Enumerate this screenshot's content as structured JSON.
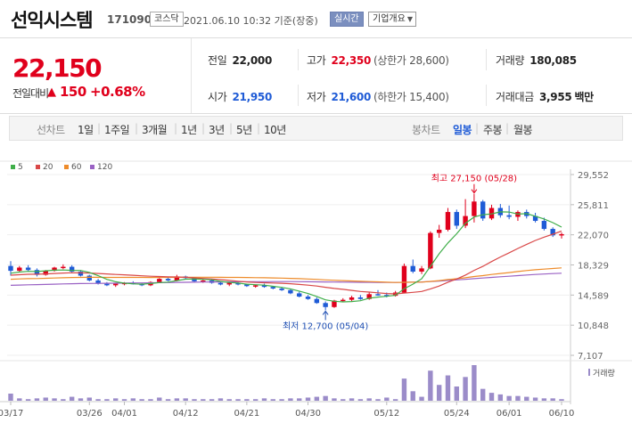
{
  "header": {
    "title": "선익시스템",
    "code": "171090",
    "market": "코스닥",
    "datetime": "2021.06.10 10:32 기준(장중)",
    "live_label": "실시간",
    "info_label": "기업개요"
  },
  "quote": {
    "price": "22,150",
    "change_label": "전일대비",
    "change_arrow": "▲",
    "change_value": "150",
    "change_pct": "+0.68%",
    "stats": {
      "prev_close": {
        "label": "전일",
        "value": "22,000"
      },
      "open": {
        "label": "시가",
        "value": "21,950"
      },
      "high": {
        "label": "고가",
        "value": "22,350",
        "sub": "(상한가 28,600)"
      },
      "low": {
        "label": "저가",
        "value": "21,600",
        "sub": "(하한가 15,400)"
      },
      "volume": {
        "label": "거래량",
        "value": "180,085"
      },
      "amount": {
        "label": "거래대금",
        "value": "3,955",
        "unit": "백만"
      }
    }
  },
  "toolbar": {
    "line_label": "선차트",
    "periods": [
      "1일",
      "1주일",
      "3개월",
      "1년",
      "3년",
      "5년",
      "10년"
    ],
    "candle_label": "봉차트",
    "candles": [
      "일봉",
      "주봉",
      "월봉"
    ],
    "active_candle": "일봉"
  },
  "colors": {
    "up": "#e0001c",
    "down": "#1f5bd6",
    "ma5": "#3fae49",
    "ma20": "#d94848",
    "ma60": "#ee8c2b",
    "ma120": "#9a62c4",
    "volume": "#9b8cc9"
  },
  "chart_data": {
    "type": "candlestick",
    "legend": [
      "5",
      "20",
      "60",
      "120"
    ],
    "y_ticks": [
      "29,552",
      "25,811",
      "22,070",
      "18,329",
      "14,589",
      "10,848",
      "7,107"
    ],
    "ylim": [
      7107,
      29552
    ],
    "x_labels": [
      "03/17",
      "03/26",
      "04/01",
      "04/12",
      "04/21",
      "04/30",
      "05/12",
      "05/24",
      "06/01",
      "06/10"
    ],
    "max_annotation": "최고 27,150 (05/28)",
    "min_annotation": "최저 12,700 (05/04)",
    "volume_label": "거래량",
    "candles": [
      [
        18200,
        18800,
        17000,
        17600
      ],
      [
        17600,
        18200,
        17400,
        18000
      ],
      [
        18000,
        18300,
        17500,
        17700
      ],
      [
        17700,
        17900,
        16900,
        17100
      ],
      [
        17100,
        17700,
        17000,
        17600
      ],
      [
        17600,
        18100,
        17500,
        18000
      ],
      [
        18000,
        18400,
        17800,
        18100
      ],
      [
        18100,
        18300,
        17400,
        17500
      ],
      [
        17500,
        17600,
        16900,
        17000
      ],
      [
        17000,
        17100,
        16300,
        16400
      ],
      [
        16400,
        16600,
        15900,
        16000
      ],
      [
        16000,
        16200,
        15700,
        15800
      ],
      [
        15800,
        16100,
        15600,
        16000
      ],
      [
        16000,
        16200,
        15800,
        16100
      ],
      [
        16100,
        16300,
        15900,
        16000
      ],
      [
        16000,
        16100,
        15700,
        15800
      ],
      [
        15800,
        16300,
        15700,
        16200
      ],
      [
        16200,
        16700,
        16100,
        16600
      ],
      [
        16600,
        16800,
        16300,
        16400
      ],
      [
        16400,
        17100,
        16300,
        16900
      ],
      [
        16900,
        17000,
        16600,
        16700
      ],
      [
        16700,
        16800,
        16200,
        16300
      ],
      [
        16300,
        16500,
        16100,
        16400
      ],
      [
        16400,
        16600,
        16000,
        16100
      ],
      [
        16100,
        16300,
        15800,
        15900
      ],
      [
        15900,
        16200,
        15700,
        16100
      ],
      [
        16100,
        16300,
        15800,
        15900
      ],
      [
        15900,
        16000,
        15600,
        15700
      ],
      [
        15700,
        15900,
        15500,
        15800
      ],
      [
        15800,
        16000,
        15500,
        15600
      ],
      [
        15600,
        15700,
        15300,
        15400
      ],
      [
        15400,
        15600,
        15100,
        15200
      ],
      [
        15200,
        15300,
        14700,
        14800
      ],
      [
        14800,
        15000,
        14300,
        14400
      ],
      [
        14400,
        14600,
        14000,
        14100
      ],
      [
        14100,
        14300,
        13500,
        13600
      ],
      [
        13600,
        13800,
        12700,
        13100
      ],
      [
        13100,
        14000,
        13000,
        13900
      ],
      [
        13900,
        14200,
        13700,
        14000
      ],
      [
        14000,
        14500,
        13800,
        14300
      ],
      [
        14300,
        14600,
        14000,
        14100
      ],
      [
        14100,
        14900,
        14000,
        14700
      ],
      [
        14700,
        15200,
        14500,
        14600
      ],
      [
        14600,
        14900,
        14300,
        14500
      ],
      [
        14500,
        15100,
        14400,
        14900
      ],
      [
        14900,
        18500,
        14800,
        18200
      ],
      [
        18200,
        19000,
        17300,
        17500
      ],
      [
        17500,
        18200,
        17200,
        17900
      ],
      [
        17900,
        22500,
        17800,
        22300
      ],
      [
        22300,
        23300,
        21700,
        22700
      ],
      [
        22700,
        25400,
        22500,
        24900
      ],
      [
        24900,
        25200,
        22800,
        23200
      ],
      [
        23200,
        26500,
        22900,
        24400
      ],
      [
        24400,
        27150,
        23600,
        26200
      ],
      [
        26200,
        26400,
        23800,
        24100
      ],
      [
        24100,
        25800,
        23900,
        25400
      ],
      [
        25400,
        25900,
        24200,
        24500
      ],
      [
        24500,
        25700,
        24000,
        24300
      ],
      [
        24300,
        25100,
        23800,
        24900
      ],
      [
        24900,
        25200,
        24100,
        24400
      ],
      [
        24400,
        24800,
        23600,
        23800
      ],
      [
        23800,
        24200,
        22600,
        22800
      ],
      [
        22800,
        23000,
        21800,
        22000
      ],
      [
        22000,
        22350,
        21600,
        22150
      ]
    ],
    "volumes": [
      9,
      3,
      2,
      3,
      4,
      3,
      2,
      5,
      3,
      4,
      2,
      2,
      3,
      2,
      3,
      2,
      2,
      4,
      2,
      3,
      3,
      2,
      2,
      2,
      3,
      2,
      2,
      2,
      2,
      3,
      2,
      2,
      3,
      3,
      4,
      5,
      6,
      3,
      2,
      3,
      2,
      3,
      2,
      4,
      2,
      28,
      12,
      5,
      38,
      20,
      32,
      18,
      30,
      45,
      15,
      10,
      8,
      6,
      6,
      5,
      4,
      3,
      3,
      2
    ]
  }
}
